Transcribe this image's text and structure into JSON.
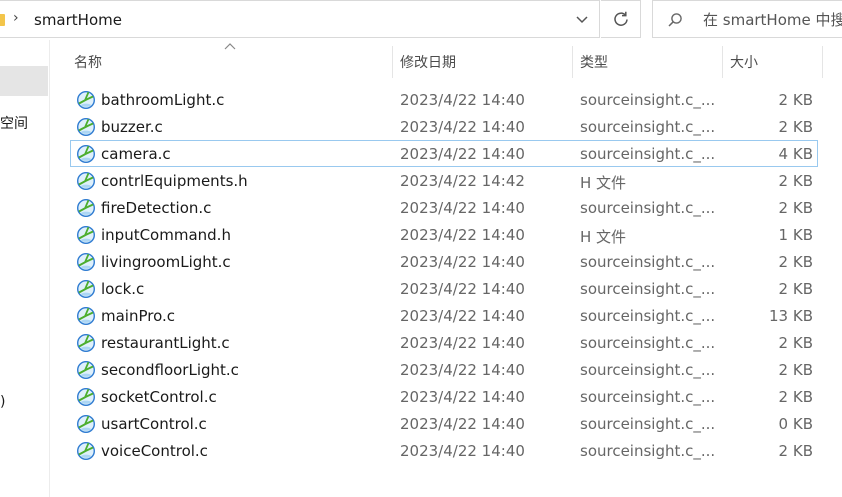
{
  "address": {
    "crumb": "smartHome",
    "separator": "›"
  },
  "search": {
    "placeholder": "在 smartHome 中搜"
  },
  "nav": {
    "item_partial_1": "空间",
    "item_partial_2": ")"
  },
  "columns": {
    "name": "名称",
    "date": "修改日期",
    "type": "类型",
    "size": "大小"
  },
  "icons": {
    "file": "source-file-icon",
    "refresh": "refresh-icon",
    "search": "search-icon",
    "dropdown": "chevron-down-icon",
    "sort": "sort-ascending-icon"
  },
  "files": [
    {
      "name": "bathroomLight.c",
      "date": "2023/4/22 14:40",
      "type": "sourceinsight.c_...",
      "size": "2 KB"
    },
    {
      "name": "buzzer.c",
      "date": "2023/4/22 14:40",
      "type": "sourceinsight.c_...",
      "size": "2 KB"
    },
    {
      "name": "camera.c",
      "date": "2023/4/22 14:40",
      "type": "sourceinsight.c_...",
      "size": "4 KB"
    },
    {
      "name": "contrlEquipments.h",
      "date": "2023/4/22 14:42",
      "type": "H 文件",
      "size": "2 KB"
    },
    {
      "name": "fireDetection.c",
      "date": "2023/4/22 14:40",
      "type": "sourceinsight.c_...",
      "size": "2 KB"
    },
    {
      "name": "inputCommand.h",
      "date": "2023/4/22 14:40",
      "type": "H 文件",
      "size": "1 KB"
    },
    {
      "name": "livingroomLight.c",
      "date": "2023/4/22 14:40",
      "type": "sourceinsight.c_...",
      "size": "2 KB"
    },
    {
      "name": "lock.c",
      "date": "2023/4/22 14:40",
      "type": "sourceinsight.c_...",
      "size": "2 KB"
    },
    {
      "name": "mainPro.c",
      "date": "2023/4/22 14:40",
      "type": "sourceinsight.c_...",
      "size": "13 KB"
    },
    {
      "name": "restaurantLight.c",
      "date": "2023/4/22 14:40",
      "type": "sourceinsight.c_...",
      "size": "2 KB"
    },
    {
      "name": "secondfloorLight.c",
      "date": "2023/4/22 14:40",
      "type": "sourceinsight.c_...",
      "size": "2 KB"
    },
    {
      "name": "socketControl.c",
      "date": "2023/4/22 14:40",
      "type": "sourceinsight.c_...",
      "size": "2 KB"
    },
    {
      "name": "usartControl.c",
      "date": "2023/4/22 14:40",
      "type": "sourceinsight.c_...",
      "size": "0 KB"
    },
    {
      "name": "voiceControl.c",
      "date": "2023/4/22 14:40",
      "type": "sourceinsight.c_...",
      "size": "2 KB"
    }
  ],
  "focused_row": 2
}
